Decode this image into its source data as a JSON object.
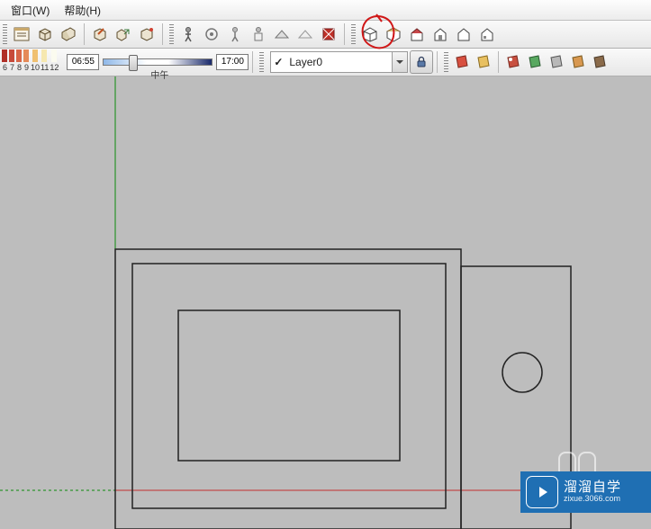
{
  "menu": {
    "window": "窗口(W)",
    "help": "帮助(H)"
  },
  "shadow": {
    "ticks": [
      "6",
      "7",
      "8",
      "9",
      "10",
      "11",
      "12"
    ],
    "colors": [
      "#b03028",
      "#c74a3a",
      "#d86648",
      "#e58a58",
      "#f0c070",
      "#f6e8b0",
      "#fbfbef"
    ],
    "time_start": "06:55",
    "noon": "中午",
    "time_end": "17:00"
  },
  "layer": {
    "check": "✓",
    "name": "Layer0"
  },
  "watermark": {
    "title": "溜溜自学",
    "sub": "zixue.3066.com"
  }
}
